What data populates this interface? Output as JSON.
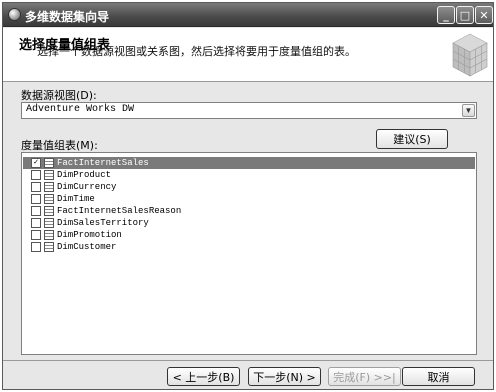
{
  "window": {
    "title": "多维数据集向导",
    "controls": [
      "minimize-icon",
      "maximize-icon",
      "close-icon"
    ]
  },
  "header": {
    "title": "选择度量值组表",
    "subtitle": "选择一个数据源视图或关系图，然后选择将要用于度量值组的表。"
  },
  "dsv": {
    "label": "数据源视图(D):",
    "value": "Adventure Works DW"
  },
  "measure_tables": {
    "label": "度量值组表(M):",
    "suggest_label": "建议(S)",
    "items": [
      {
        "name": "FactInternetSales",
        "checked": true,
        "selected": true
      },
      {
        "name": "DimProduct",
        "checked": false,
        "selected": false
      },
      {
        "name": "DimCurrency",
        "checked": false,
        "selected": false
      },
      {
        "name": "DimTime",
        "checked": false,
        "selected": false
      },
      {
        "name": "FactInternetSalesReason",
        "checked": false,
        "selected": false
      },
      {
        "name": "DimSalesTerritory",
        "checked": false,
        "selected": false
      },
      {
        "name": "DimPromotion",
        "checked": false,
        "selected": false
      },
      {
        "name": "DimCustomer",
        "checked": false,
        "selected": false
      }
    ]
  },
  "footer": {
    "back": "< 上一步(B)",
    "next": "下一步(N) >",
    "finish": "完成(F) >>|",
    "cancel": "取消"
  },
  "colors": {
    "titlebar": "#4a4a4a",
    "selected_row": "#7a7a7a",
    "dialog_bg": "#e7e7e7"
  }
}
